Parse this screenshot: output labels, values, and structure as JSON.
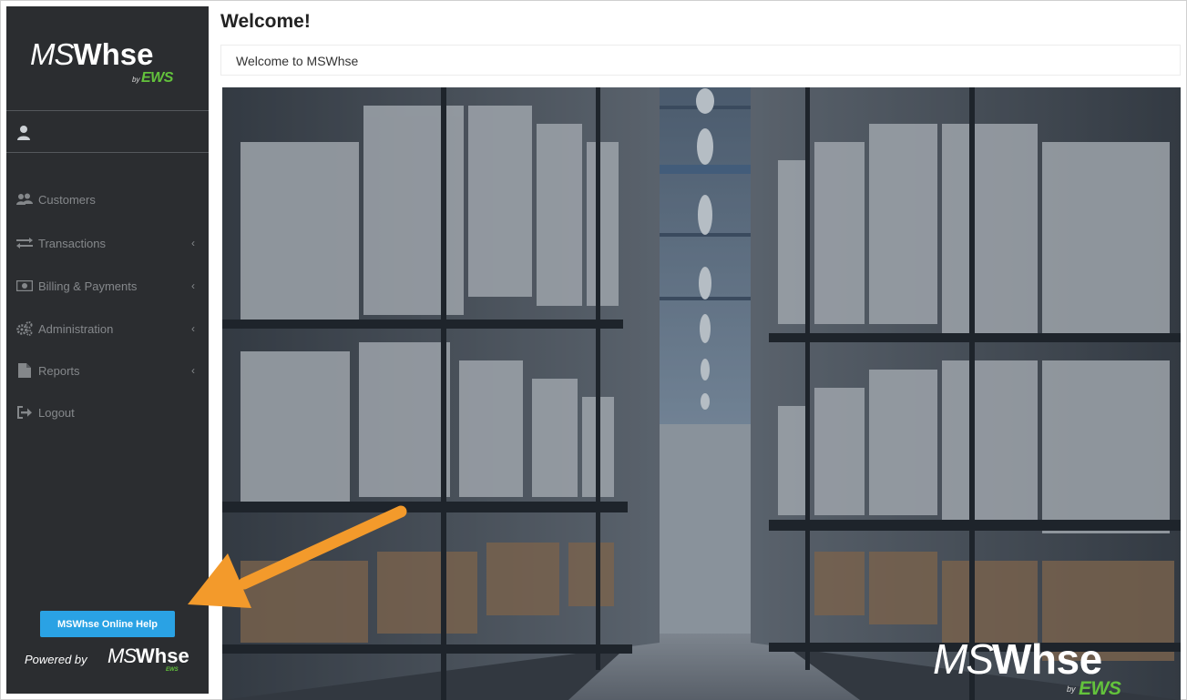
{
  "brand": {
    "ms": "MS",
    "whse": "Whse",
    "by": "by",
    "ews": "EWS"
  },
  "header": {
    "title": "Welcome!",
    "welcome_text": "Welcome to MSWhse"
  },
  "sidebar": {
    "items": [
      {
        "label": "Customers",
        "icon": "users-icon",
        "has_submenu": false
      },
      {
        "label": "Transactions",
        "icon": "exchange-icon",
        "has_submenu": true
      },
      {
        "label": "Billing & Payments",
        "icon": "money-icon",
        "has_submenu": true
      },
      {
        "label": "Administration",
        "icon": "gears-icon",
        "has_submenu": true
      },
      {
        "label": "Reports",
        "icon": "file-icon",
        "has_submenu": true
      },
      {
        "label": "Logout",
        "icon": "sign-out-icon",
        "has_submenu": false
      }
    ],
    "help_button": "MSWhse Online Help",
    "powered_by": "Powered by"
  },
  "colors": {
    "sidebar_bg": "#2b2d30",
    "help_button": "#2aa2e4",
    "ews_green": "#63c23c",
    "arrow": "#f39a2b"
  }
}
